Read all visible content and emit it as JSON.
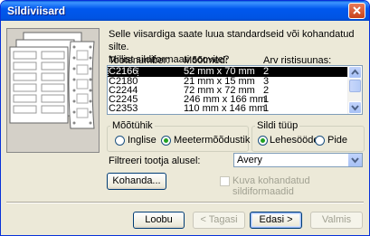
{
  "window": {
    "title": "Sildiviisard"
  },
  "intro": [
    "Selle viisardiga saate luua standardseid või kohandatud silte.",
    "Millist sildiformaati soovite?"
  ],
  "columns": [
    "Tootenumber:",
    "Mõõtmed:",
    "Arv ristisuunas:"
  ],
  "rows": [
    [
      "C2166",
      "52 mm x 70 mm",
      "2"
    ],
    [
      "C2180",
      "21 mm x 15 mm",
      "3"
    ],
    [
      "C2244",
      "72 mm x 72 mm",
      "2"
    ],
    [
      "C2245",
      "246 mm x 166 mm",
      "1"
    ],
    [
      "C2353",
      "110 mm x 146 mm",
      "1"
    ]
  ],
  "unit_group": {
    "label": "Mõõtühik",
    "options": [
      "Inglise",
      "Meetermõõdustik"
    ],
    "selected": "Meetermõõdustik"
  },
  "type_group": {
    "label": "Sildi tüüp",
    "options": [
      "Lehesööde",
      "Pide"
    ],
    "selected": "Lehesööde"
  },
  "filter": {
    "label": "Filtreeri tootja alusel:",
    "value": "Avery"
  },
  "customize_label": "Kohanda...",
  "show_custom_label": "Kuva kohandatud sildiformaadid",
  "buttons": {
    "cancel": "Loobu",
    "back": "< Tagasi",
    "next": "Edasi >",
    "finish": "Valmis"
  }
}
